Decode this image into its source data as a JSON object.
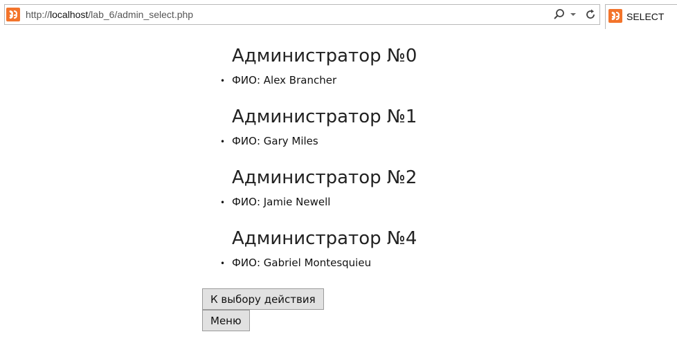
{
  "browser": {
    "url_prefix": "http://",
    "url_host": "localhost",
    "url_path": "/lab_6/admin_select.php",
    "tab_title": "SELECT",
    "icons": {
      "site": "xampp-icon",
      "search": "search-icon",
      "dropdown": "chevron-down-icon",
      "refresh": "refresh-icon"
    },
    "accent_color": "#f3742b"
  },
  "admins": [
    {
      "heading": "Администратор №0",
      "fio": "ФИО: Alex Brancher"
    },
    {
      "heading": "Администратор №1",
      "fio": "ФИО: Gary Miles"
    },
    {
      "heading": "Администратор №2",
      "fio": "ФИО: Jamie Newell"
    },
    {
      "heading": "Администратор №4",
      "fio": "ФИО: Gabriel Montesquieu"
    }
  ],
  "buttons": {
    "back_label": "К выбору действия",
    "menu_label": "Меню"
  },
  "bullet": "•"
}
